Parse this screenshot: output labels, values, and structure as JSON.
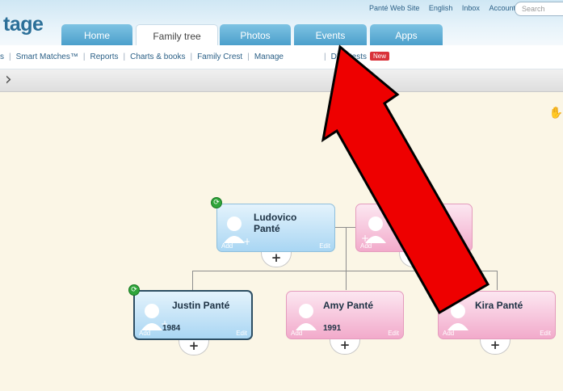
{
  "header": {
    "logo_text": "tage",
    "links": {
      "site": "Panté Web Site",
      "language": "English",
      "inbox": "Inbox",
      "account": "Account ▾"
    },
    "search_placeholder": "Search"
  },
  "tabs": [
    {
      "label": "Home"
    },
    {
      "label": "Family tree"
    },
    {
      "label": "Photos"
    },
    {
      "label": "Events"
    },
    {
      "label": "Apps"
    }
  ],
  "subnav": {
    "items": [
      "s",
      "Smart Matches™",
      "Reports",
      "Charts & books",
      "Family Crest",
      "Manage"
    ],
    "dna": "DNA tests",
    "new_badge": "New"
  },
  "colors": {
    "male_card": "#a9d6f3",
    "female_card": "#f2aacb",
    "annotation_arrow": "#ee0000",
    "sync_badge": "#2fa53a"
  },
  "people": [
    {
      "id": "ludovico",
      "name": "Ludovico Panté",
      "name_line1": "Ludovico",
      "name_line2": "Panté",
      "year": "",
      "gender": "male",
      "add": "Add",
      "edit": "Edit"
    },
    {
      "id": "partner",
      "name": "",
      "year": "",
      "gender": "female",
      "add": "Add",
      "edit": ""
    },
    {
      "id": "justin",
      "name": "Justin Panté",
      "year": "1984",
      "gender": "male",
      "add": "Add",
      "edit": "Edit",
      "selected": true
    },
    {
      "id": "amy",
      "name": "Amy Panté",
      "year": "1991",
      "gender": "female",
      "add": "Add",
      "edit": "Edit"
    },
    {
      "id": "kira",
      "name": "Kira Panté",
      "year": "",
      "gender": "female",
      "add": "Add",
      "edit": "Edit"
    }
  ],
  "icons": {
    "expand": "+",
    "nav": "›",
    "hand": "✋",
    "sync": "⟳"
  }
}
